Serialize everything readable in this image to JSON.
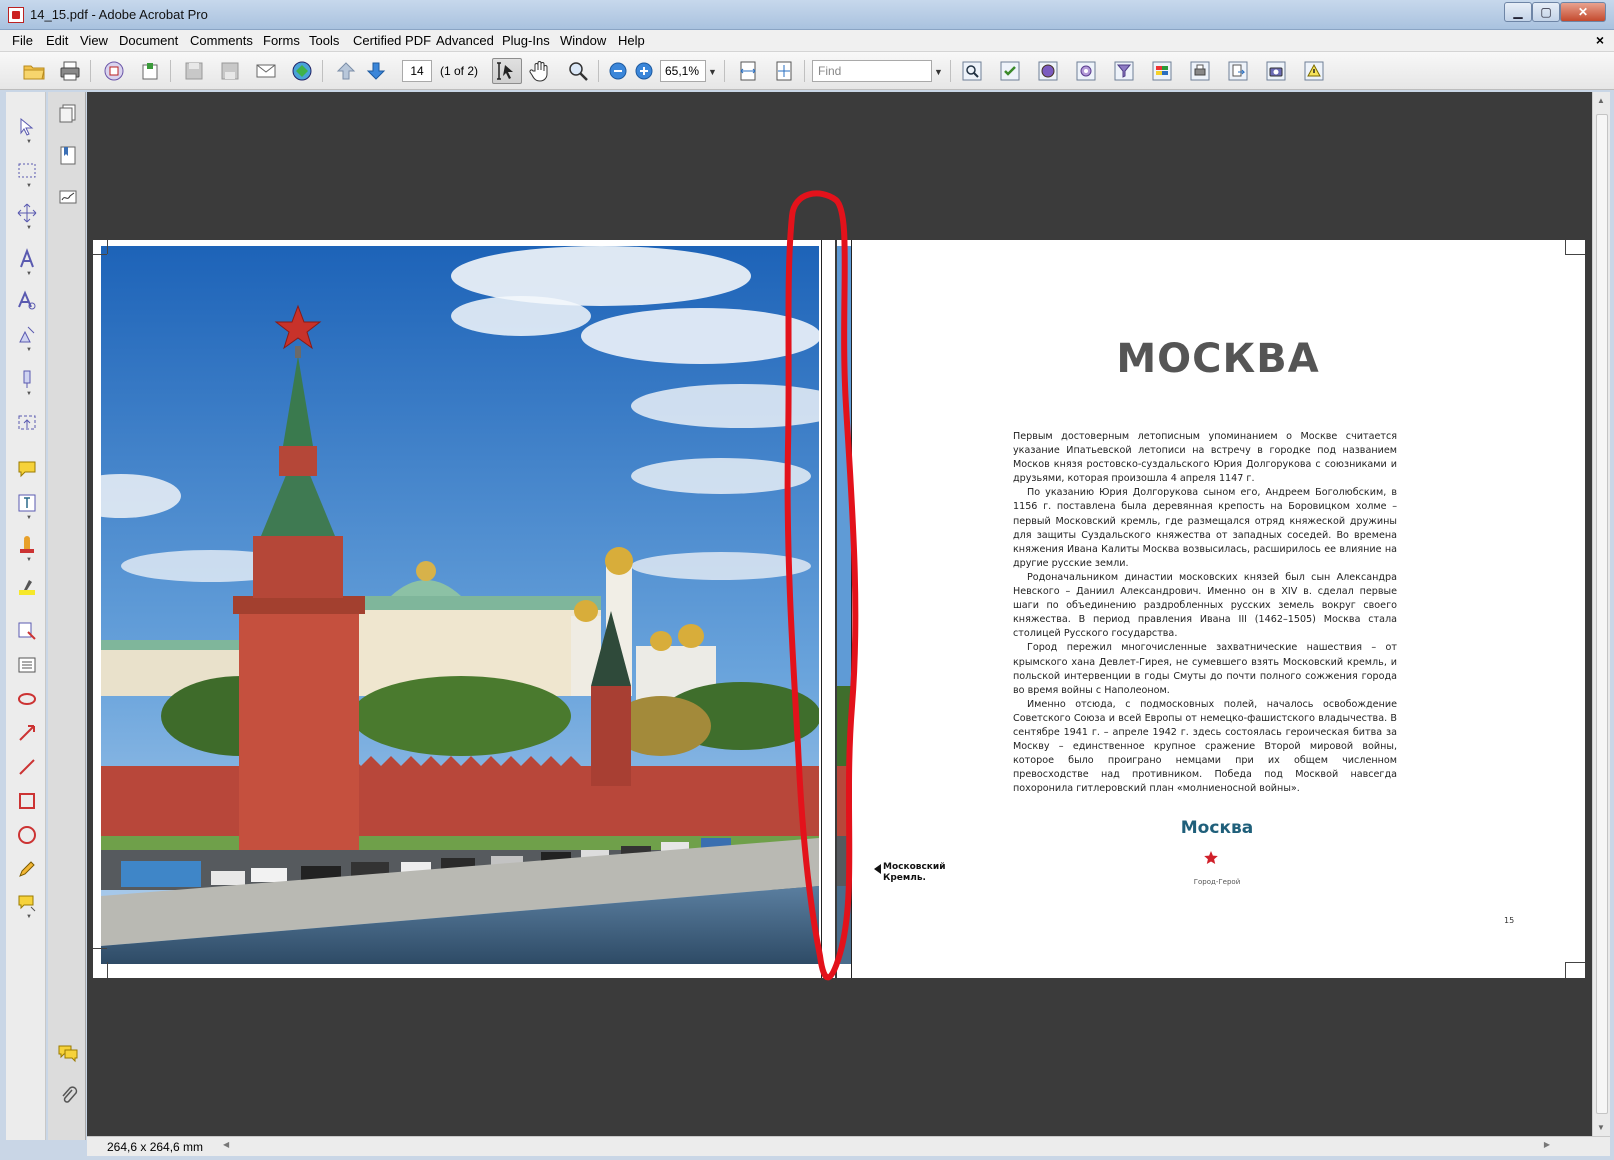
{
  "window": {
    "title": "14_15.pdf - Adobe Acrobat Pro",
    "min_glyph": "▁",
    "max_glyph": "▢",
    "close_glyph": "✕"
  },
  "menu": {
    "items": [
      "File",
      "Edit",
      "View",
      "Document",
      "Comments",
      "Forms",
      "Tools",
      "Certified PDF",
      "Advanced",
      "Plug-Ins",
      "Window",
      "Help"
    ],
    "doc_close": "×"
  },
  "toolbar": {
    "page_number": "14",
    "page_of": "(1 of 2)",
    "zoom": "65,1%",
    "find_placeholder": "Find"
  },
  "status": {
    "dimensions": "264,6 x 264,6 mm"
  },
  "page_right": {
    "title": "МОСКВА",
    "paragraphs": [
      "Первым достоверным летописным упоминанием о Москве считается указание Ипатьевской летописи на встречу в городке под названием Москов князя ростовско-суздальского Юрия Долгорукова с союзниками и друзьями, которая произошла 4 апреля 1147 г.",
      "По указанию Юрия Долгорукова сыном его, Андреем Боголюбским, в 1156 г. поставлена была деревянная крепость на Боровицком холме – первый Московский кремль, где размещался отряд княжеской дружины для защиты Суздальского княжества от западных соседей. Во времена княжения Ивана Калиты Москва возвысилась, расширилось ее влияние на другие русские земли.",
      "Родоначальником династии московских князей был сын Александра Невского – Даниил Александрович. Именно он в XIV в. сделал первые шаги по объединению раздробленных русских земель вокруг своего княжества. В период правления Ивана III (1462–1505) Москва стала столицей Русского государства.",
      "Город пережил многочисленные захватнические нашествия – от крымского хана Девлет-Гирея, не сумевшего взять Московский кремль, и польской интервенции в годы Смуты до почти полного сожжения города во время войны с Наполеоном.",
      "Именно отсюда, с подмосковных полей, началось освобождение Советского Союза и всей Европы от немецко-фашистского владычества. В сентябре 1941 г. – апреле 1942 г. здесь состоялась героическая битва за Москву – единственное крупное сражение Второй мировой войны, которое было проиграно немцами при их общем численном превосходстве над противником. Победа под Москвой навсегда похоронила гитлеровский план «молниеносной войны»."
    ],
    "caption_line1": "Московский",
    "caption_line2": "Кремль.",
    "brand": "Москва",
    "brand_sub": "Город-Герой",
    "page_number": "15"
  },
  "colors": {
    "annotation_red": "#e3121b",
    "brand_teal": "#1f5f7a",
    "doc_background": "#3b3b3b"
  },
  "icons": {
    "toolbar": [
      "open-icon",
      "print-icon",
      "create-pdf-icon",
      "export-icon",
      "save-icon",
      "save-disk-icon",
      "email-icon",
      "collaborate-icon",
      "previous-page-icon",
      "next-page-icon",
      "select-tool-icon",
      "hand-tool-icon",
      "zoom-tool-icon",
      "zoom-out-icon",
      "zoom-in-icon",
      "fit-width-icon",
      "fit-page-icon",
      "search-icon",
      "check-icon",
      "globe-icon",
      "preflight-icon",
      "filter-icon",
      "color-icon",
      "print-production-icon",
      "export-page-icon",
      "snapshot-icon",
      "warning-icon"
    ]
  }
}
